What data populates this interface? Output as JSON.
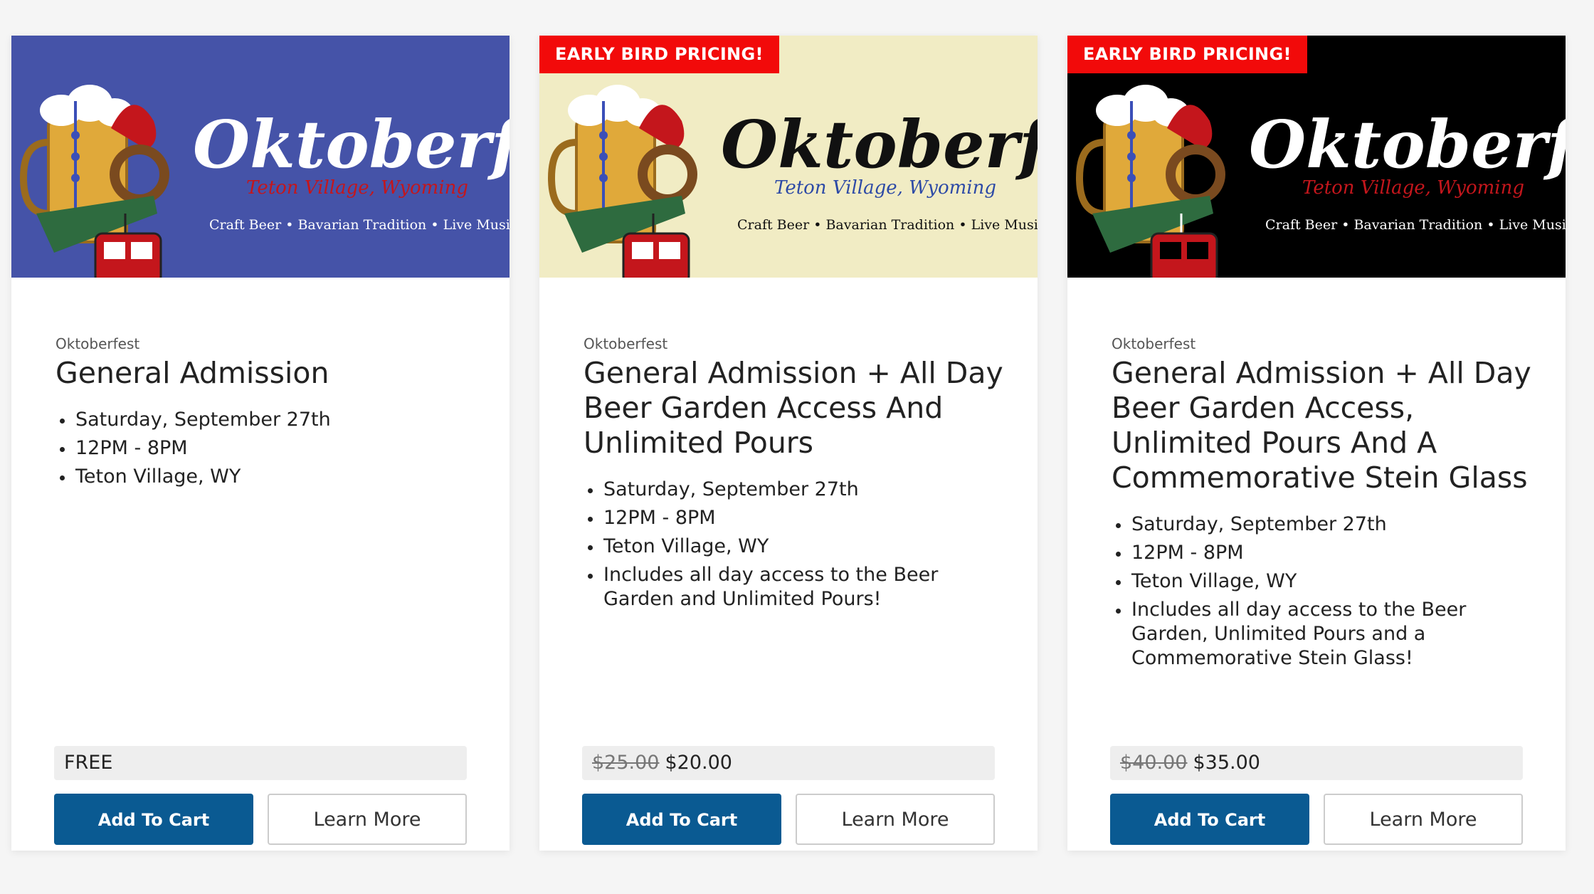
{
  "cards": [
    {
      "banner_bg": "#4553a8",
      "banner_theme": "blue",
      "ribbon": "",
      "logo": {
        "title": "Oktoberfest",
        "location": "Teton Village, Wyoming",
        "tagline": "Craft Beer • Bavarian Tradition • Live Music"
      },
      "category": "Oktoberfest",
      "title": "General Admission",
      "details": [
        "Saturday, September 27th",
        "12PM - 8PM",
        "Teton Village, WY"
      ],
      "price_old": "",
      "price": "FREE",
      "add_to_cart": "Add To Cart",
      "learn_more": "Learn More"
    },
    {
      "banner_bg": "#f1ecc4",
      "banner_theme": "cream",
      "ribbon": "EARLY BIRD PRICING!",
      "logo": {
        "title": "Oktoberfest",
        "location": "Teton Village, Wyoming",
        "tagline": "Craft Beer • Bavarian Tradition • Live Music"
      },
      "category": "Oktoberfest",
      "title": "General Admission + All Day Beer Garden Access And Unlimited Pours",
      "details": [
        "Saturday, September 27th",
        "12PM - 8PM",
        "Teton Village, WY",
        "Includes all day access to the Beer Garden and Unlimited Pours!"
      ],
      "price_old": "$25.00",
      "price": "$20.00",
      "add_to_cart": "Add To Cart",
      "learn_more": "Learn More"
    },
    {
      "banner_bg": "#000000",
      "banner_theme": "black",
      "ribbon": "EARLY BIRD PRICING!",
      "logo": {
        "title": "Oktoberfest",
        "location": "Teton Village, Wyoming",
        "tagline": "Craft Beer • Bavarian Tradition • Live Music"
      },
      "category": "Oktoberfest",
      "title": "General Admission + All Day Beer Garden Access, Unlimited Pours And A Commemorative Stein Glass",
      "details": [
        "Saturday, September 27th",
        "12PM - 8PM",
        "Teton Village, WY",
        "Includes all day access to the Beer Garden, Unlimited Pours and a Commemorative Stein Glass!"
      ],
      "price_old": "$40.00",
      "price": "$35.00",
      "add_to_cart": "Add To Cart",
      "learn_more": "Learn More"
    }
  ],
  "colors": {
    "primary_button": "#0a5a92",
    "ribbon": "#f20a0a",
    "page_bg": "#f5f5f5",
    "logo_red": "#c4161c",
    "logo_beer": "#e0a93a",
    "logo_green": "#2e6b3f"
  }
}
